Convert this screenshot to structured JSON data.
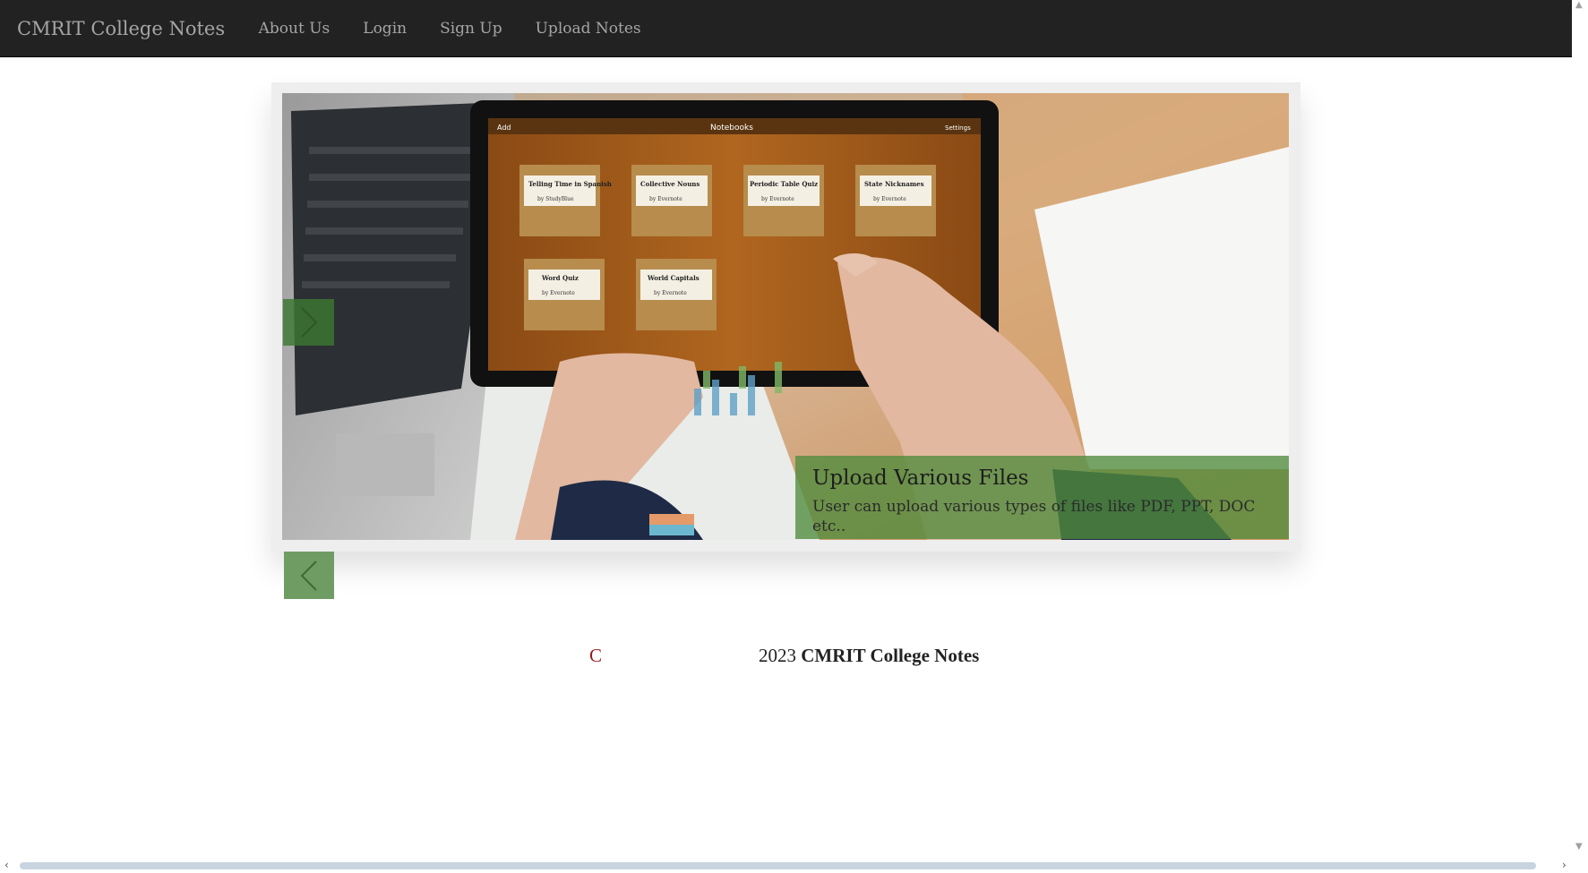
{
  "navbar": {
    "brand": "CMRIT College Notes",
    "links": [
      "About Us",
      "Login",
      "Sign Up",
      "Upload Notes"
    ]
  },
  "slider": {
    "caption_title": "Upload Various Files",
    "caption_text": "User can upload various types of files like PDF, PPT, DOC etc..",
    "tablet_header": "Notebooks",
    "tablet_add": "Add",
    "tablet_settings": "Settings",
    "notebooks": [
      {
        "title": "Telling Time in Spanish",
        "by": "by StudyBlue"
      },
      {
        "title": "Collective Nouns",
        "by": "by Evernote"
      },
      {
        "title": "Periodic Table Quiz",
        "by": "by Evernote"
      },
      {
        "title": "State Nicknames",
        "by": "by Evernote"
      },
      {
        "title": "Word Quiz",
        "by": "by Evernote"
      },
      {
        "title": "World Capitals",
        "by": "by Evernote"
      }
    ]
  },
  "footer": {
    "copyright_symbol": "C",
    "year": "2023",
    "site_name": "CMRIT College Notes"
  },
  "colors": {
    "navbar_bg": "#222222",
    "nav_text": "#a5a5a5",
    "caption_bg": "#508c3c",
    "arrow_bg": "#3c7832",
    "copyright_color": "#9b1c1c"
  },
  "icons": {
    "next_arrow": "chevron-right-icon",
    "prev_arrow": "chevron-left-icon"
  }
}
